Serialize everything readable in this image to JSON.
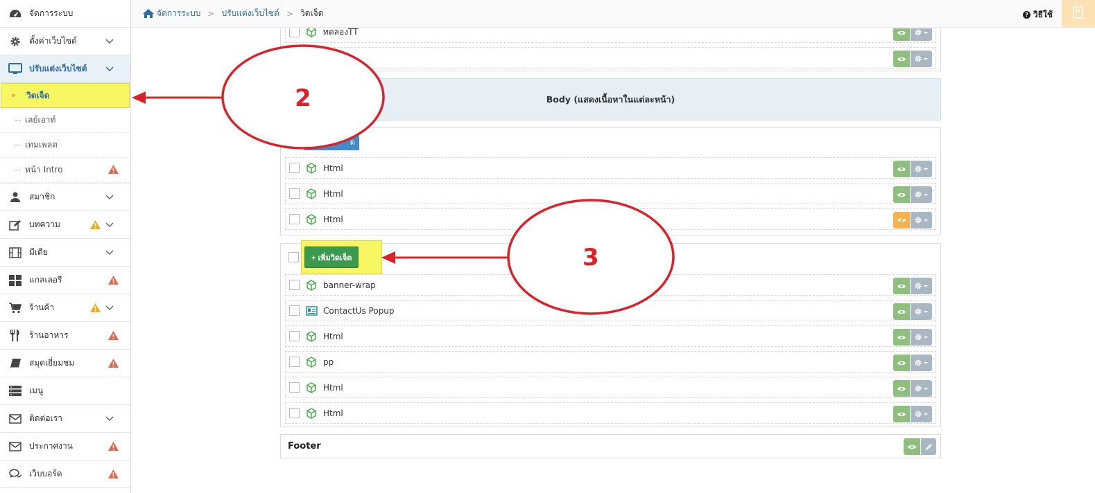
{
  "sidebar": {
    "items": [
      {
        "label": "จัดการระบบ"
      },
      {
        "label": "ตั้งค่าเว็บไซต์"
      },
      {
        "label": "ปรับแต่งเว็บไซต์"
      },
      {
        "label": "สมาชิก"
      },
      {
        "label": "บทความ"
      },
      {
        "label": "มีเดีย"
      },
      {
        "label": "แกลเลอรี"
      },
      {
        "label": "ร้านค้า"
      },
      {
        "label": "ร้านอาหาร"
      },
      {
        "label": "สมุดเยี่ยมชม"
      },
      {
        "label": "เมนู"
      },
      {
        "label": "ติดต่อเรา"
      },
      {
        "label": "ประกาศงาน"
      },
      {
        "label": "เว็บบอร์ด"
      }
    ],
    "sub_items": [
      {
        "label": "วิดเจ็ด"
      },
      {
        "label": "เลย์เอาท์"
      },
      {
        "label": "เทมเพลต"
      },
      {
        "label": "หน้า Intro"
      }
    ],
    "selected_marker": "»"
  },
  "breadcrumb": {
    "home": "จัดการระบบ",
    "level2": "ปรับแต่งเว็บไซต์",
    "current": "วิดเจ็ด",
    "separator": ">"
  },
  "help": {
    "icon_text": "?",
    "label": "วิธีใช้"
  },
  "header_widgets": [
    {
      "name": "ทดลองTT",
      "icon": "cube-icon"
    },
    {
      "name": "",
      "icon": ""
    }
  ],
  "body_section": {
    "title": "Body (แสดงเนื้อหาในแต่ละหน้า)",
    "hidden_button_label": "ด",
    "widgets": [
      {
        "name": "Html",
        "icon": "cube-icon",
        "eye": "visible"
      },
      {
        "name": "Html",
        "icon": "cube-icon",
        "eye": "visible"
      },
      {
        "name": "Html",
        "icon": "cube-icon",
        "eye": "hidden"
      }
    ]
  },
  "second_section": {
    "add_button_label": "+ เพิ่มวิดเจ็ด",
    "widgets": [
      {
        "name": "banner-wrap",
        "icon": "cube-icon"
      },
      {
        "name": "ContactUs Popup",
        "icon": "contact-card-icon"
      },
      {
        "name": "Html",
        "icon": "cube-icon"
      },
      {
        "name": "pp",
        "icon": "cube-icon"
      },
      {
        "name": "Html",
        "icon": "cube-icon"
      },
      {
        "name": "Html",
        "icon": "cube-icon"
      }
    ]
  },
  "footer": {
    "label": "Footer"
  },
  "annotations": [
    {
      "number": "2"
    },
    {
      "number": "3"
    }
  ],
  "colors": {
    "accent": "#2e6da4",
    "highlight": "#f7f764",
    "annotation": "#d9222a",
    "eye_green": "#8fbf7f",
    "eye_orange": "#f7b24d",
    "add_green": "#3c9a4f"
  }
}
